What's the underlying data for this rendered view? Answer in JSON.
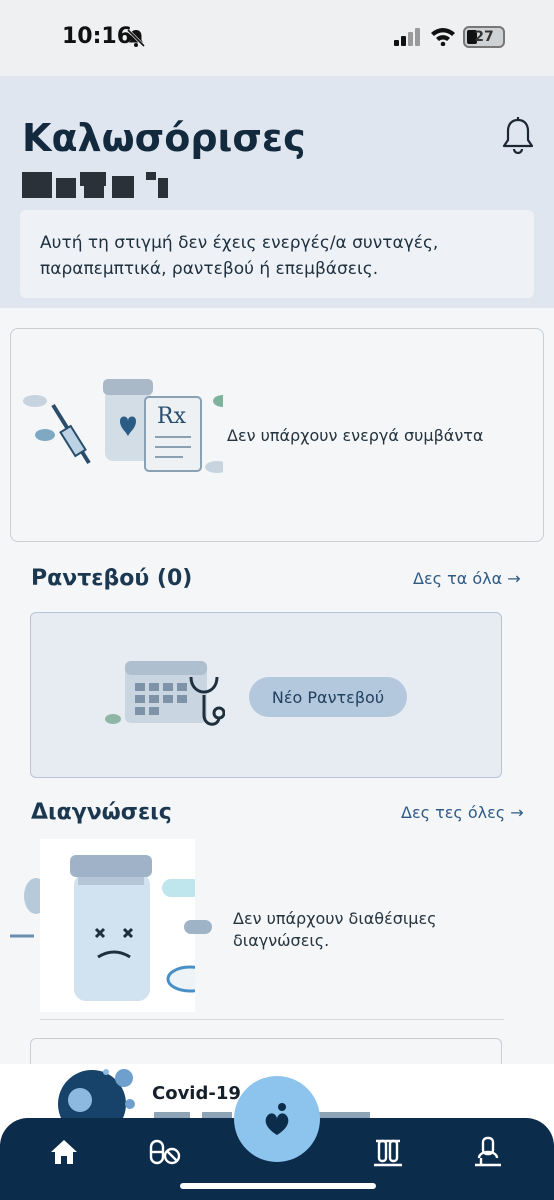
{
  "status_bar": {
    "time": "10:16",
    "battery": "27"
  },
  "header": {
    "title": "Καλωσόρισες",
    "notice": "Αυτή τη στιγμή δεν έχεις ενεργές/α συνταγές, παραπεμπτικά, ραντεβού ή επεμβάσεις."
  },
  "events": {
    "empty_text": "Δεν υπάρχουν ενεργά συμβάντα"
  },
  "appointments": {
    "title": "Ραντεβού (0)",
    "see_all": "Δες τα όλα →",
    "new_button": "Νέο Ραντεβού"
  },
  "diagnoses": {
    "title": "Διαγνώσεις",
    "see_all": "Δες τες όλες →",
    "empty_text_line1": "Δεν υπάρχουν διαθέσιμες",
    "empty_text_line2": "διαγνώσεις."
  },
  "covid": {
    "title": "Covid-19"
  },
  "tabbar": {
    "items": [
      {
        "icon": "home-icon"
      },
      {
        "icon": "pills-icon"
      },
      {
        "icon": "app-logo-icon"
      },
      {
        "icon": "test-tubes-icon"
      },
      {
        "icon": "microscope-icon"
      }
    ]
  },
  "colors": {
    "navy": "#0c2c4c",
    "fab": "#8cc4ee",
    "header_bg": "#dfe6ef",
    "link": "#2f5a86"
  }
}
